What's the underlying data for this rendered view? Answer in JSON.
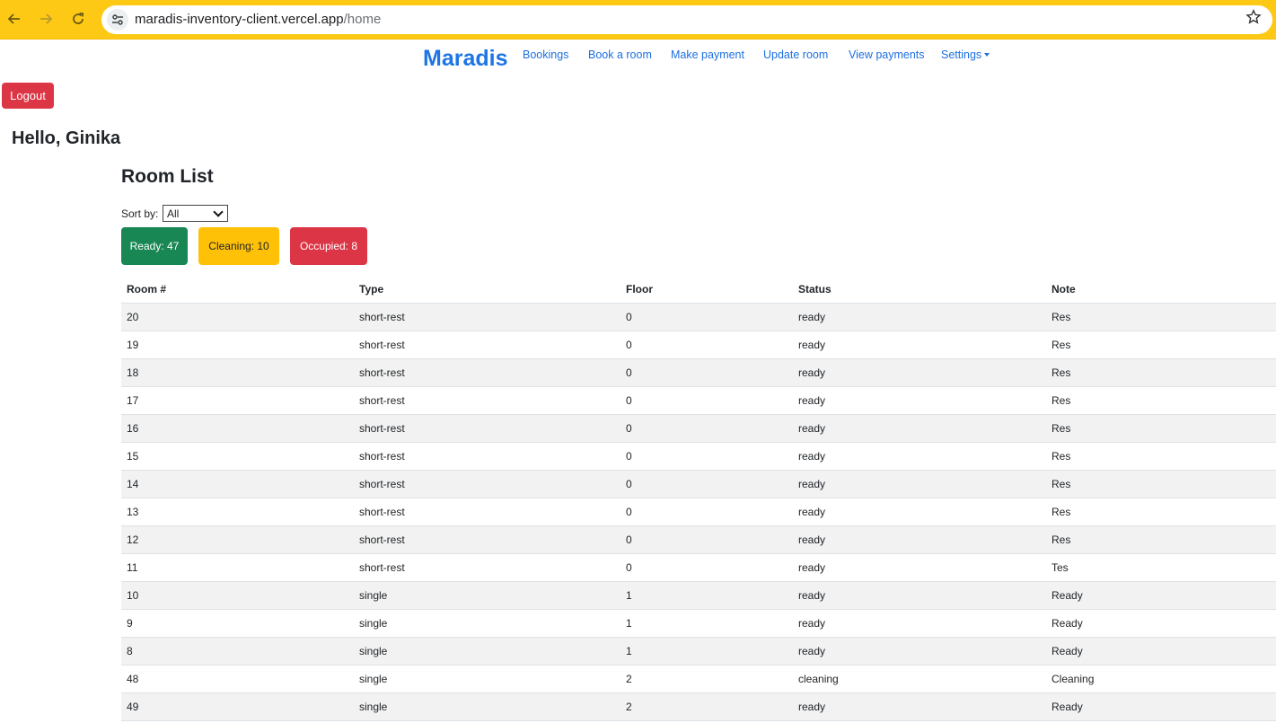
{
  "browser": {
    "url_host": "maradis-inventory-client.vercel.app",
    "url_path": "/home",
    "icons": [
      "back-arrow-icon",
      "forward-arrow-icon",
      "reload-icon",
      "site-settings-icon",
      "bookmark-star-icon"
    ]
  },
  "navbar": {
    "brand": "Maradis",
    "links": [
      "Bookings",
      "Book a room",
      "Make payment",
      "Update room",
      "View payments",
      "Settings"
    ]
  },
  "logout_label": "Logout",
  "greeting": "Hello, Ginika",
  "room_list": {
    "title": "Room List",
    "sort_label": "Sort by:",
    "sort_value": "All",
    "counts": {
      "ready": "Ready: 47",
      "cleaning": "Cleaning: 10",
      "occupied": "Occupied: 8"
    },
    "colors": {
      "ready": "#198754",
      "cleaning": "#ffc107",
      "occupied": "#dc3545",
      "brand": "#1d74e6",
      "browser_bar": "#fec915"
    },
    "columns": [
      "Room #",
      "Type",
      "Floor",
      "Status",
      "Note"
    ],
    "rows": [
      [
        "20",
        "short-rest",
        "0",
        "ready",
        "Res"
      ],
      [
        "19",
        "short-rest",
        "0",
        "ready",
        "Res"
      ],
      [
        "18",
        "short-rest",
        "0",
        "ready",
        "Res"
      ],
      [
        "17",
        "short-rest",
        "0",
        "ready",
        "Res"
      ],
      [
        "16",
        "short-rest",
        "0",
        "ready",
        "Res"
      ],
      [
        "15",
        "short-rest",
        "0",
        "ready",
        "Res"
      ],
      [
        "14",
        "short-rest",
        "0",
        "ready",
        "Res"
      ],
      [
        "13",
        "short-rest",
        "0",
        "ready",
        "Res"
      ],
      [
        "12",
        "short-rest",
        "0",
        "ready",
        "Res"
      ],
      [
        "11",
        "short-rest",
        "0",
        "ready",
        "Tes"
      ],
      [
        "10",
        "single",
        "1",
        "ready",
        "Ready"
      ],
      [
        "9",
        "single",
        "1",
        "ready",
        "Ready"
      ],
      [
        "8",
        "single",
        "1",
        "ready",
        "Ready"
      ],
      [
        "48",
        "single",
        "2",
        "cleaning",
        "Cleaning"
      ],
      [
        "49",
        "single",
        "2",
        "ready",
        "Ready"
      ]
    ]
  }
}
